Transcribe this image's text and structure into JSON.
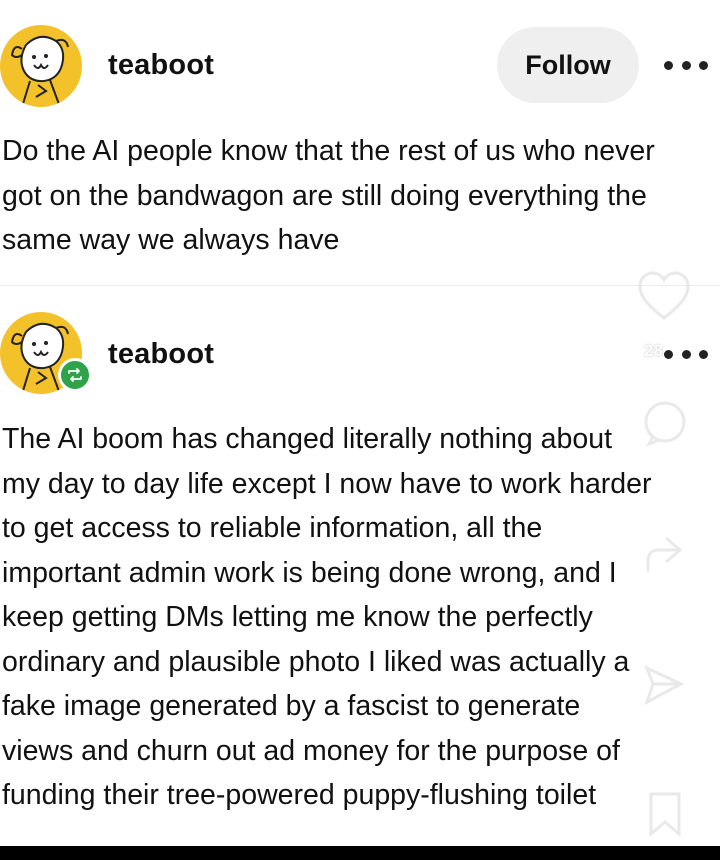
{
  "posts": [
    {
      "username": "teaboot",
      "follow_label": "Follow",
      "body_lines": [
        "Do the AI people know that the rest of us who never",
        "got on the bandwagon are still doing everything the",
        "same way we always have"
      ]
    },
    {
      "username": "teaboot",
      "reblogged": true,
      "body_lines": [
        "The AI boom has changed literally nothing about",
        "my day to day life except I now have to work harder",
        "to get access to reliable information, all the",
        "important admin work is being done wrong, and I",
        "keep getting DMs letting me know the perfectly",
        "ordinary and plausible photo I liked was actually a",
        "fake image generated by a fascist to generate",
        "views and churn out ad money for the purpose of",
        "funding their tree-powered puppy-flushing toilet"
      ]
    }
  ],
  "action_rail": {
    "like_count": "28",
    "icons": [
      "heart-icon",
      "reply-icon",
      "share-icon",
      "send-icon",
      "bookmark-icon"
    ]
  },
  "colors": {
    "avatar_background": "#f3c12a",
    "reblog_badge": "#2fa34a",
    "follow_button_bg": "#efefef"
  }
}
